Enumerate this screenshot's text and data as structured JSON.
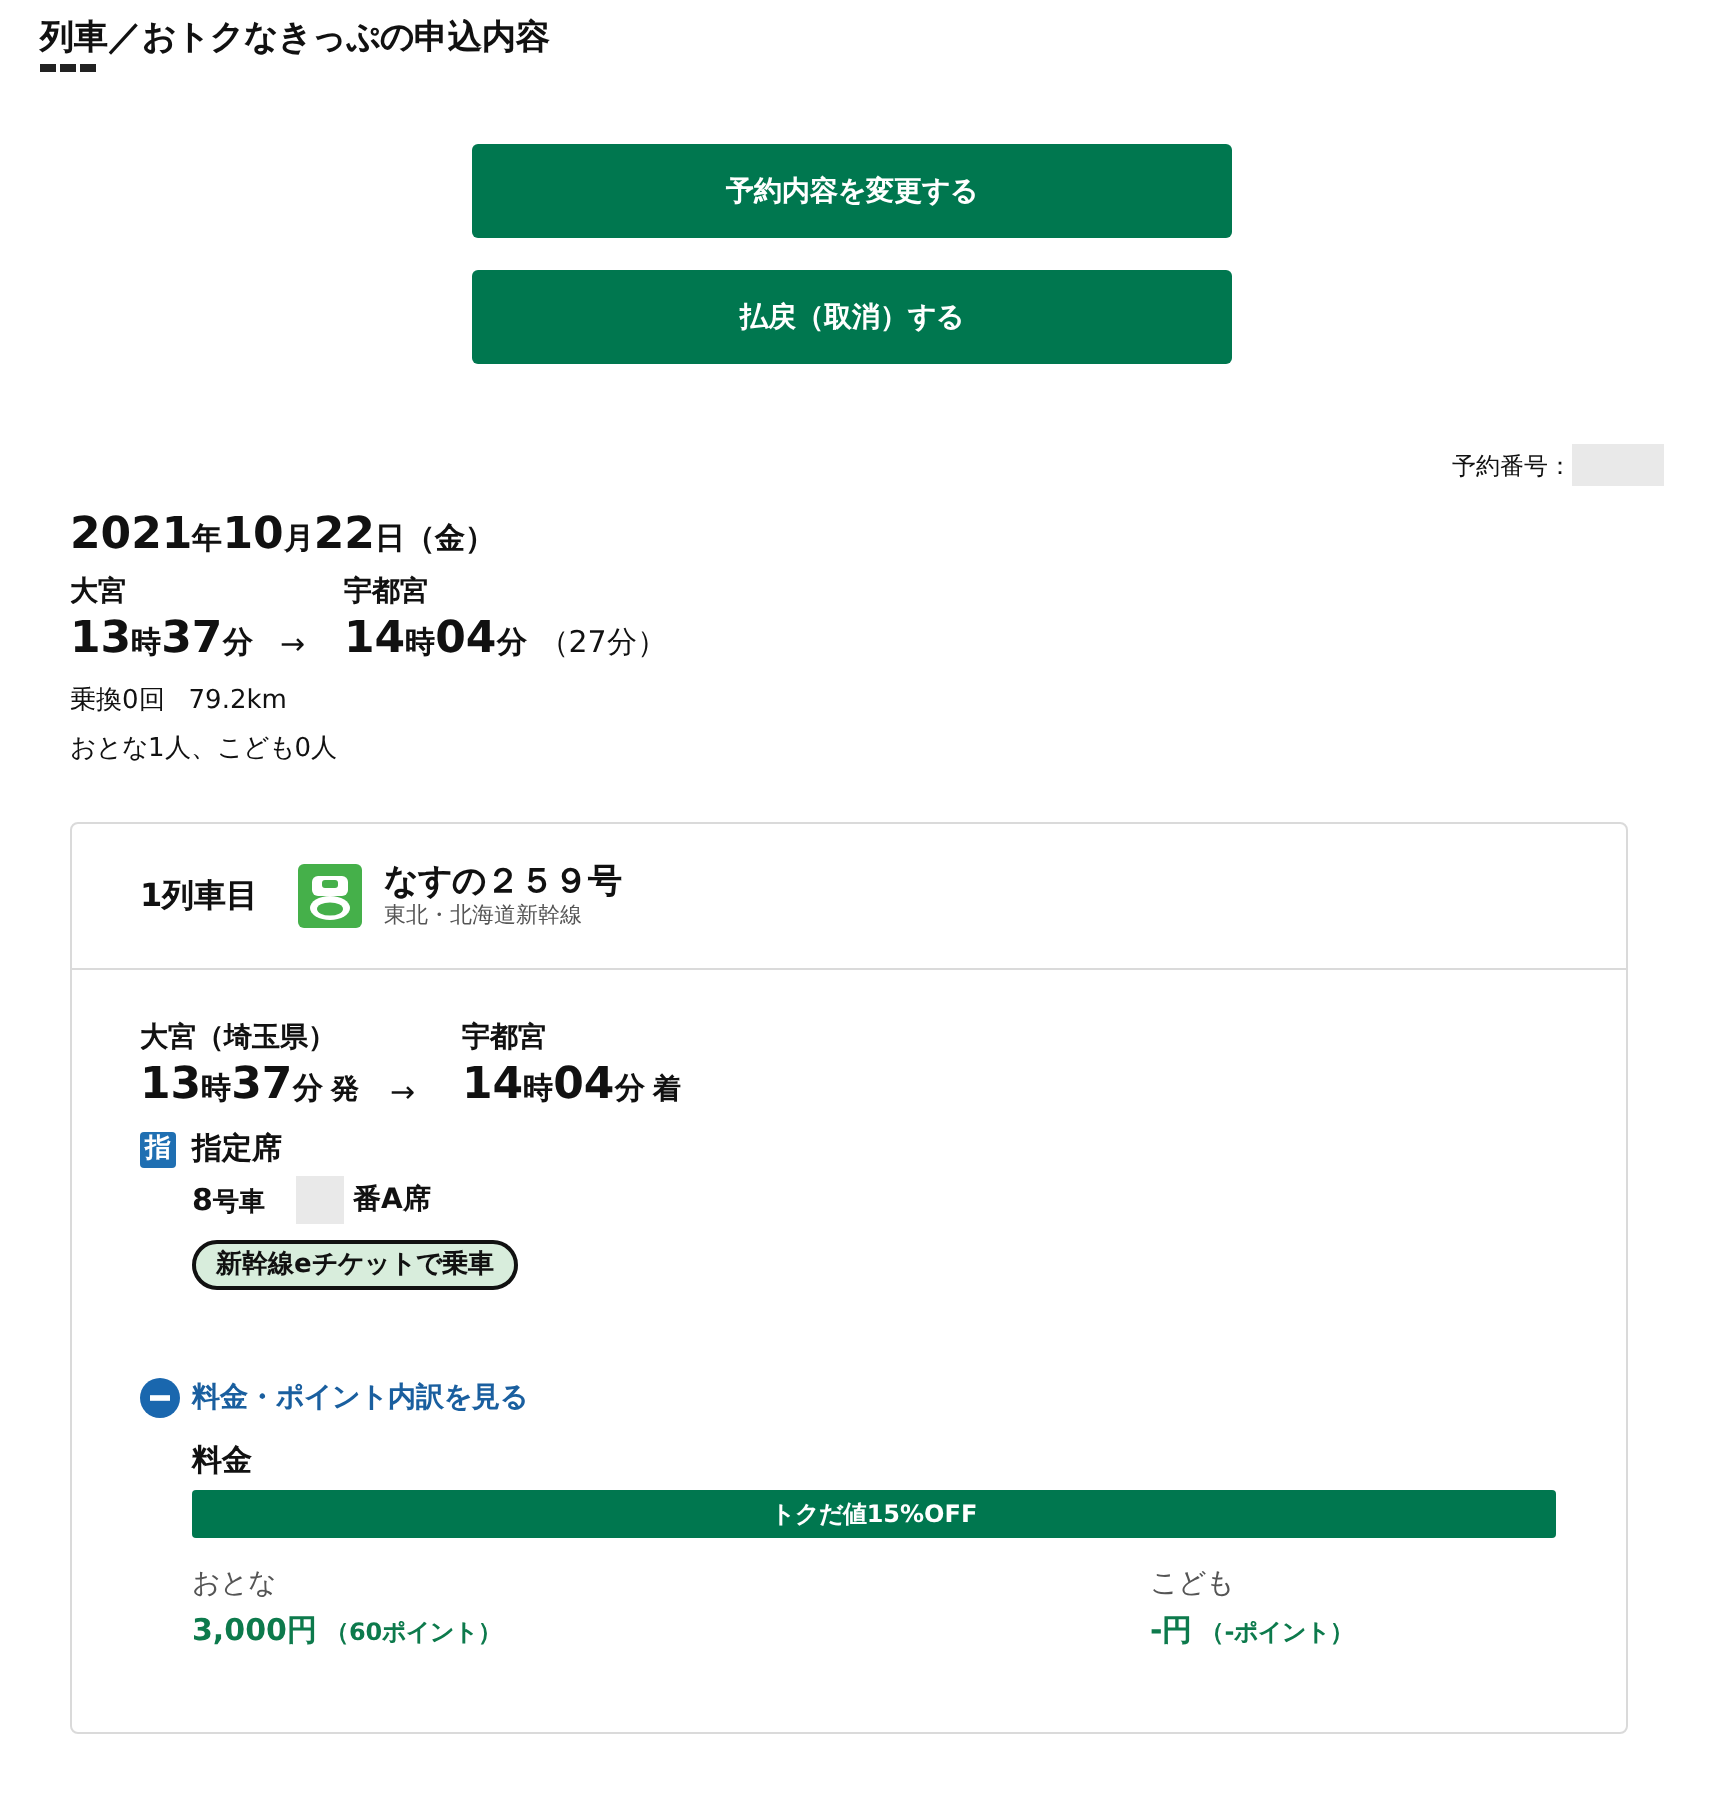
{
  "page_title": "列車／おトクなきっぷの申込内容",
  "actions": [
    {
      "label": "予約内容を変更する"
    },
    {
      "label": "払戻（取消）する"
    }
  ],
  "reservation_number": {
    "label": "予約番号："
  },
  "trip": {
    "date": "2021年10月22日（金）",
    "from": {
      "station": "大宮",
      "time": "13時37分"
    },
    "arrow": "→",
    "to": {
      "station": "宇都宮",
      "time": "14時04分"
    },
    "duration": "（27分）",
    "transfers": "乗換0回",
    "distance": "79.2km",
    "passengers": "おとな1人、こども0人"
  },
  "trains": [
    {
      "index_label": "1列車目",
      "name": "なすの２５９号",
      "line": "東北・北海道新幹線",
      "departure": {
        "station": "大宮（埼玉県）",
        "time": "13時37分",
        "suffix": "発"
      },
      "arrow": "→",
      "arrival": {
        "station": "宇都宮",
        "time": "14時04分",
        "suffix": "着"
      },
      "seat_type_mark": "指",
      "seat_type": "指定席",
      "car": "8号車",
      "seat": "番A席",
      "ticket_badge": "新幹線eチケットで乗車",
      "fare_toggle": {
        "label": "料金・ポイント内訳を見る",
        "expanded": true
      },
      "fare": {
        "heading": "料金",
        "discount": "トクだ値15%OFF",
        "prices": [
          {
            "passenger": "おとな",
            "amount": "3,000円",
            "points": "（60ポイント）"
          },
          {
            "passenger": "こども",
            "amount": "-円",
            "points": "（-ポイント）"
          }
        ]
      }
    }
  ]
}
